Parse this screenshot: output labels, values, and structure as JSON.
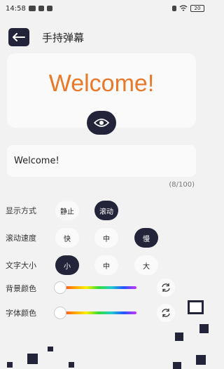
{
  "status_bar": {
    "time": "14:58",
    "battery": "20"
  },
  "header": {
    "title": "手持弹幕"
  },
  "preview": {
    "text": "Welcome!",
    "text_color": "#e8782a"
  },
  "input": {
    "value": "Welcome!",
    "count": "(8/100)"
  },
  "display_mode": {
    "label": "显示方式",
    "options": [
      "静止",
      "滚动"
    ],
    "selected": "滚动"
  },
  "scroll_speed": {
    "label": "滚动速度",
    "options": [
      "快",
      "中",
      "慢"
    ],
    "selected": "慢"
  },
  "font_size": {
    "label": "文字大小",
    "options": [
      "小",
      "中",
      "大"
    ],
    "selected": "小"
  },
  "background_color": {
    "label": "背景颜色"
  },
  "font_color": {
    "label": "字体颜色"
  },
  "colors": {
    "accent": "#23243a",
    "background": "#f2f2f2",
    "card": "#fafafa"
  }
}
